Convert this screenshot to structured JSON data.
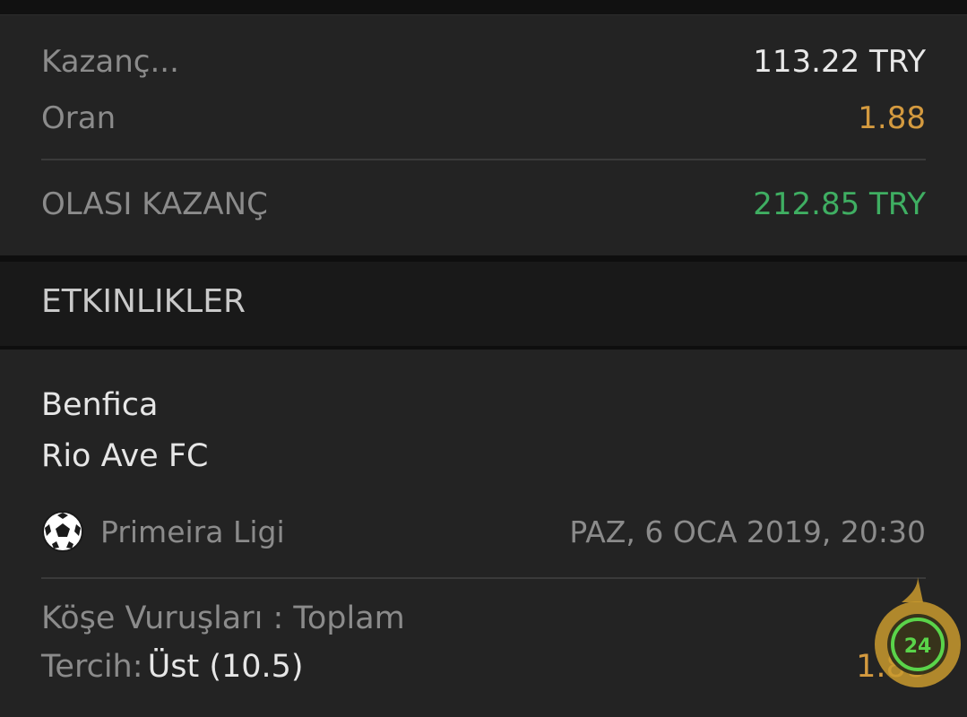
{
  "summary": {
    "kazanc_label": "Kazanç...",
    "kazanc_value": "113.22 TRY",
    "oran_label": "Oran",
    "oran_value": "1.88",
    "olasi_label": "OLASI KAZANÇ",
    "olasi_value": "212.85 TRY"
  },
  "section": {
    "title": "ETKINLIKLER"
  },
  "event": {
    "home_team": "Benfica",
    "away_team": "Rio Ave FC",
    "sport_icon": "soccer-ball-icon",
    "league": "Primeira Ligi",
    "datetime": "PAZ, 6 OCA 2019, 20:30",
    "market": "Köşe Vuruşları : Toplam",
    "pick_label": "Tercih:",
    "pick_value": "Üst (10.5)",
    "pick_odds": "1.88"
  },
  "support": {
    "icon": "support-24-icon",
    "badge_text": "24"
  },
  "colors": {
    "background": "#232323",
    "accent_orange": "#d49a3f",
    "accent_green": "#3fae62"
  }
}
